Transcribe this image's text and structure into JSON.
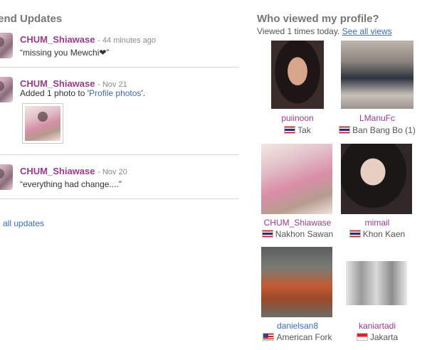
{
  "left": {
    "title": "iend Updates",
    "updates": [
      {
        "user": "CHUM_Shiawase",
        "time": "- 44 minutes ago",
        "text": "“missing you Mewchi❤”"
      },
      {
        "user": "CHUM_Shiawase",
        "time": "- Nov 21",
        "text_prefix": "Added 1 photo to '",
        "text_link": "Profile photos",
        "text_suffix": "'."
      },
      {
        "user": "CHUM_Shiawase",
        "time": "- Nov 20",
        "text": "“everything had change....”"
      }
    ],
    "all_updates": "all updates"
  },
  "right": {
    "title": "Who viewed my profile?",
    "viewed_prefix": "Viewed 1 times today.",
    "see_all": "See all views",
    "viewers": [
      {
        "name": "puiinoon",
        "location": "Tak",
        "flag": "thailand-flag-icon",
        "name_color": "#9b3b8f"
      },
      {
        "name": "LManuFc",
        "location": "Ban Bang Bo (1)",
        "flag": "thailand-flag-icon",
        "name_color": "#9b3b8f"
      },
      {
        "name": "CHUM_Shiawase",
        "location": "Nakhon Sawan",
        "flag": "thailand-flag-icon",
        "name_color": "#9b3b8f"
      },
      {
        "name": "mimail",
        "location": "Khon Kaen",
        "flag": "thailand-flag-icon",
        "name_color": "#9b3b8f"
      },
      {
        "name": "danielsan8",
        "location": "American Fork",
        "flag": "usa-flag-icon",
        "name_color": "#3b6fb6"
      },
      {
        "name": "kaniartadi",
        "location": "Jakarta",
        "flag": "indonesia-flag-icon",
        "name_color": "#9b3b8f"
      }
    ]
  }
}
